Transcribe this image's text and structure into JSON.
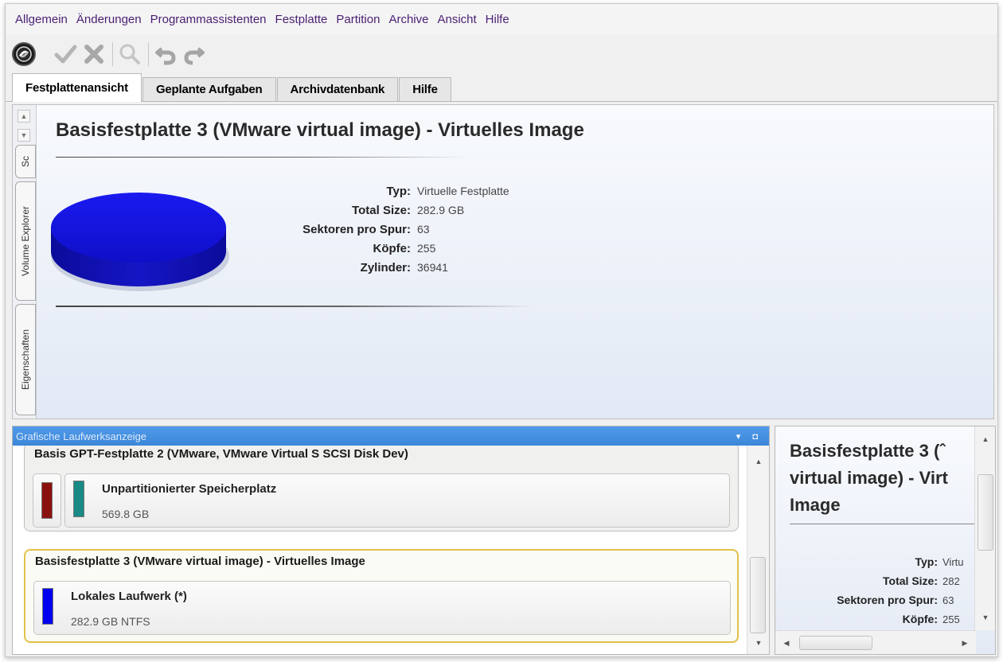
{
  "menu": [
    "Allgemein",
    "Änderungen",
    "Programmassistenten",
    "Festplatte",
    "Partition",
    "Archive",
    "Ansicht",
    "Hilfe"
  ],
  "toolbar": {
    "icons": [
      "app-logo-icon",
      "apply-checkmark-icon",
      "discard-x-icon",
      "search-magnifier-icon",
      "undo-arrow-icon",
      "redo-arrow-icon"
    ]
  },
  "tabs": [
    "Festplattenansicht",
    "Geplante Aufgaben",
    "Archivdatenbank",
    "Hilfe"
  ],
  "active_tab": "Festplattenansicht",
  "side_tabs": [
    "Sc",
    "Volume Explorer",
    "Eigenschaften"
  ],
  "disk_view": {
    "title": "Basisfestplatte 3 (VMware virtual image) - Virtuelles Image",
    "properties": [
      {
        "label": "Typ:",
        "value": "Virtuelle Festplatte"
      },
      {
        "label": "Total Size:",
        "value": "282.9 GB"
      },
      {
        "label": "Sektoren pro Spur:",
        "value": "63"
      },
      {
        "label": "Köpfe:",
        "value": "255"
      },
      {
        "label": "Zylinder:",
        "value": "36941"
      }
    ],
    "disk_color": "#1414d8"
  },
  "graphical_panel": {
    "header": "Grafische Laufwerksanzeige",
    "disks": [
      {
        "title": "Basis GPT-Festplatte 2 (VMware, VMware Virtual S SCSI Disk Dev)",
        "partitions": [
          {
            "name": "Unpartitionierter Speicherplatz",
            "size": "569.8 GB",
            "color": "#1a8a86"
          }
        ],
        "marker_color": "#8a1010"
      },
      {
        "title": "Basisfestplatte 3 (VMware virtual image) - Virtuelles Image",
        "partitions": [
          {
            "name": "Lokales Laufwerk (*)",
            "size": "282.9 GB NTFS",
            "color": "#0000ee"
          }
        ],
        "selected": true
      }
    ]
  },
  "side_panel": {
    "title_lines": [
      "Basisfestplatte 3 (ˆ",
      "virtual image) - Virt",
      "Image"
    ],
    "properties": [
      {
        "label": "Typ:",
        "value": "Virtu"
      },
      {
        "label": "Total Size:",
        "value": "282"
      },
      {
        "label": "Sektoren pro Spur:",
        "value": "63"
      },
      {
        "label": "Köpfe:",
        "value": "255"
      }
    ]
  }
}
